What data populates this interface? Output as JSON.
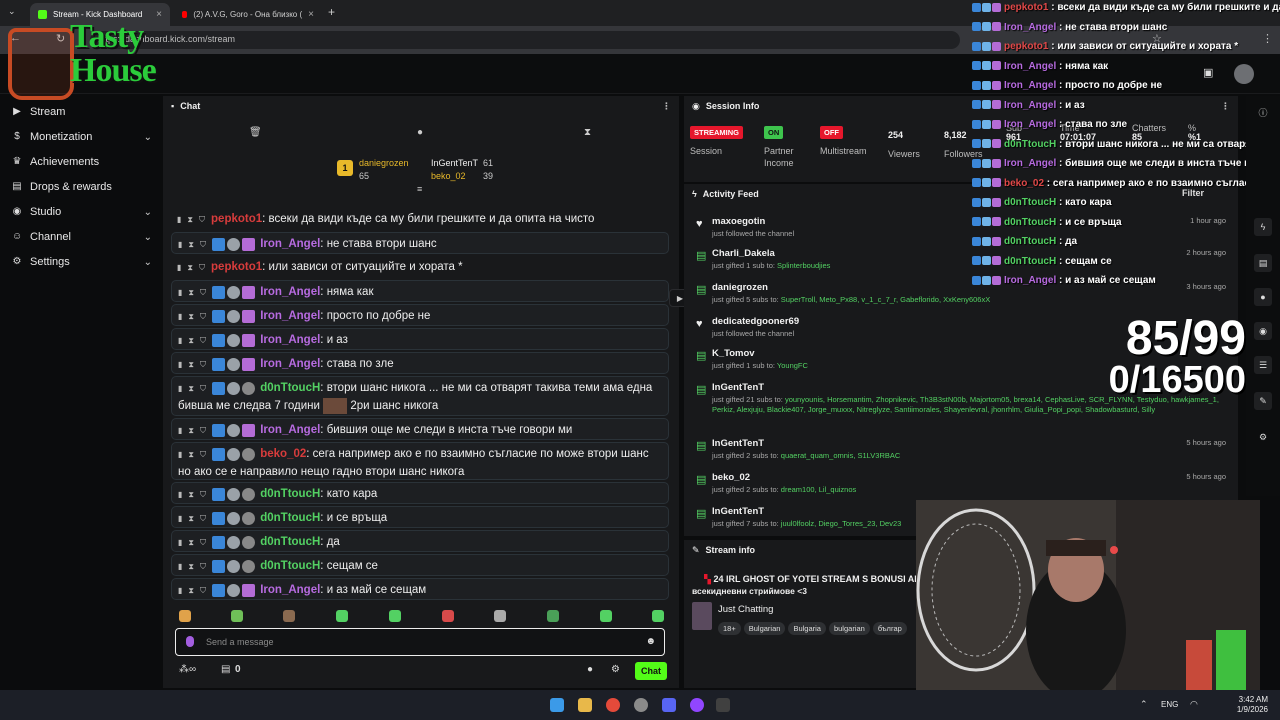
{
  "browser": {
    "tabs": [
      {
        "label": "Stream - Kick Dashboard",
        "active": true
      },
      {
        "label": "(2) A.V.G, Goro - Она близко (",
        "active": false
      }
    ],
    "url": "https://dashboard.kick.com/stream"
  },
  "logo": {
    "line1": "Tasty",
    "line2": "House"
  },
  "sidebar": {
    "items": [
      {
        "label": "Stream",
        "has_chevron": false
      },
      {
        "label": "Monetization",
        "has_chevron": true
      },
      {
        "label": "Achievements",
        "has_chevron": false
      },
      {
        "label": "Drops & rewards",
        "has_chevron": false
      },
      {
        "label": "Studio",
        "has_chevron": true
      },
      {
        "label": "Channel",
        "has_chevron": true
      },
      {
        "label": "Settings",
        "has_chevron": true
      }
    ]
  },
  "chat": {
    "title": "Chat",
    "leaders": [
      {
        "rank": "1",
        "name": "daniegrozen",
        "count": "65"
      },
      {
        "name": "InGentTenT",
        "count": "61"
      },
      {
        "name": "beko_02",
        "count": "39"
      }
    ],
    "messages": [
      {
        "user": "pepkoto1",
        "text": "всеки да види къде са му били грешките и да опита на чисто",
        "color": "#d83c3c"
      },
      {
        "user": "Iron_Angel",
        "text": "не става втори шанс",
        "color": "#b76be0"
      },
      {
        "user": "pepkoto1",
        "text": "или зависи от ситуацийте и хората *",
        "color": "#d83c3c"
      },
      {
        "user": "Iron_Angel",
        "text": "няма как",
        "color": "#b76be0"
      },
      {
        "user": "Iron_Angel",
        "text": "просто по добре не",
        "color": "#b76be0"
      },
      {
        "user": "Iron_Angel",
        "text": "и аз",
        "color": "#b76be0"
      },
      {
        "user": "Iron_Angel",
        "text": "става по зле",
        "color": "#b76be0"
      },
      {
        "user": "d0nTtoucH",
        "text": "втори шанс никога ... не ми са отварят такива теми ама една бивша ме следва 7 години",
        "text2": "2ри шанс никога",
        "color": "#53d163"
      },
      {
        "user": "Iron_Angel",
        "text": "бившия още ме следи в инста тъче говори ми",
        "color": "#b76be0"
      },
      {
        "user": "beko_02",
        "text": "сега например ако е по взаимно съгласие по може втори шанс но ако се е направило нещо гадно втори шанс никога",
        "color": "#d83c3c"
      },
      {
        "user": "d0nTtoucH",
        "text": "като кара",
        "color": "#53d163"
      },
      {
        "user": "d0nTtoucH",
        "text": "и се връща",
        "color": "#53d163"
      },
      {
        "user": "d0nTtoucH",
        "text": "да",
        "color": "#53d163"
      },
      {
        "user": "d0nTtoucH",
        "text": "сещам се",
        "color": "#53d163"
      },
      {
        "user": "Iron_Angel",
        "text": "и аз май се сещам",
        "color": "#b76be0"
      }
    ],
    "input_placeholder": "Send a message",
    "footer_count": "0",
    "send_label": "Chat"
  },
  "session": {
    "title": "Session Info",
    "status": {
      "pill": "STREAMING",
      "label": "Session"
    },
    "partner": {
      "pill": "ON",
      "label": "Partner Income"
    },
    "multistream": {
      "pill": "OFF",
      "label": "Multistream"
    },
    "viewers": {
      "value": "254",
      "label": "Viewers"
    },
    "followers": {
      "value": "8,182",
      "label": "Followers"
    },
    "subs": {
      "value": "961",
      "label": "Sub"
    },
    "time": {
      "value": "07:01:07",
      "label": "Time"
    },
    "chatters": {
      "value": "85",
      "label": "Chatters"
    },
    "percent": {
      "value": "%1",
      "label": "%"
    }
  },
  "activity": {
    "title": "Activity Feed",
    "filter_label": "Filter",
    "items": [
      {
        "icon": "heart",
        "name": "maxoegotin",
        "desc": "just followed the channel",
        "time": "1 hour ago"
      },
      {
        "icon": "gift",
        "name": "Charli_Dakela",
        "desc": "just gifted 1 sub to: ",
        "recipients": "Splinterboudjies",
        "time": "2 hours ago"
      },
      {
        "icon": "gift",
        "name": "daniegrozen",
        "desc": "just gifted 5 subs to: ",
        "recipients": "SuperTroll, Meto_Px88, v_1_c_7_r, Gabeflorido, XxKeny606xX",
        "time": "3 hours ago"
      },
      {
        "icon": "heart",
        "name": "dedicatedgooner69",
        "desc": "just followed the channel",
        "time": ""
      },
      {
        "icon": "gift",
        "name": "K_Tomov",
        "desc": "just gifted 1 sub to: ",
        "recipients": "YoungFC",
        "time": ""
      },
      {
        "icon": "gift",
        "name": "InGentTenT",
        "desc": "just gifted 21 subs to: ",
        "recipients": "younyounis, Horsemantim, Zhopnikevic, Th3B3stN00b, Majortom05, brexa14, CephasLive, SCR_FLYNN, Testyduo, hawkjames_1, Perkiz, Alexjuju, Blackie407, Jorge_muxxx, Nitreglyze, Santiimorales, Shayenlevral, jhonrhlm, Giulia_Popi_popi, Shadowbasturd, Silly",
        "time": ""
      },
      {
        "icon": "gift",
        "name": "InGentTenT",
        "desc": "just gifted 2 subs to: ",
        "recipients": "quaerat_quam_omnis, S1LV3RBAC",
        "time": "5 hours ago"
      },
      {
        "icon": "gift",
        "name": "beko_02",
        "desc": "just gifted 2 subs to: ",
        "recipients": "dream100, Lil_quiznos",
        "time": "5 hours ago"
      },
      {
        "icon": "gift",
        "name": "InGentTenT",
        "desc": "just gifted 7 subs to: ",
        "recipients": "juul0lfoolz, Diego_Torres_23, Dev23",
        "time": ""
      }
    ]
  },
  "stream_info": {
    "title": "Stream info",
    "stream_title": "24 IRL GHOST OF YOTEI STREAM S BONUSI AN",
    "stream_title2": "всекидневни стриймове <3",
    "category": "Just Chatting",
    "tags": [
      "18+",
      "Bulgarian",
      "Bulgaria",
      "bulgarian",
      "българ"
    ]
  },
  "overlay": {
    "messages": [
      {
        "user": "pepkoto1",
        "text": "всеки да види къде са му били грешките и да опит",
        "color": "#e04848"
      },
      {
        "user": "Iron_Angel",
        "text": "не става втори шанс",
        "color": "#b76be0"
      },
      {
        "user": "pepkoto1",
        "text": "или зависи от ситуацийте и хората *",
        "color": "#e04848"
      },
      {
        "user": "Iron_Angel",
        "text": "няма как",
        "color": "#b76be0"
      },
      {
        "user": "Iron_Angel",
        "text": "просто по добре не",
        "color": "#b76be0"
      },
      {
        "user": "Iron_Angel",
        "text": "и аз",
        "color": "#b76be0"
      },
      {
        "user": "Iron_Angel",
        "text": "става по зле",
        "color": "#b76be0"
      },
      {
        "user": "d0nTtoucH",
        "text": "втори шанс никога ... не ми са отварят такив",
        "color": "#53d163"
      },
      {
        "user": "Iron_Angel",
        "text": "бившия още ме следи в инста тъче говори",
        "color": "#b76be0"
      },
      {
        "user": "beko_02",
        "text": "сега например ако е по взаимно съгласие",
        "color": "#e04848"
      },
      {
        "user": "d0nTtoucH",
        "text": "като кара",
        "color": "#53d163"
      },
      {
        "user": "d0nTtoucH",
        "text": "и се връща",
        "color": "#53d163"
      },
      {
        "user": "d0nTtoucH",
        "text": "да",
        "color": "#53d163"
      },
      {
        "user": "d0nTtoucH",
        "text": "сещам се",
        "color": "#53d163"
      },
      {
        "user": "Iron_Angel",
        "text": "и аз май се сещам",
        "color": "#b76be0"
      }
    ]
  },
  "counter": {
    "line1": "85/99",
    "line2": "0/16500"
  },
  "taskbar": {
    "lang": "ENG",
    "time": "3:42 AM",
    "date": "1/9/2026"
  },
  "colors": {
    "kick_green": "#53fc18",
    "streaming_red": "#e6172c",
    "panel_bg": "#18191b"
  }
}
